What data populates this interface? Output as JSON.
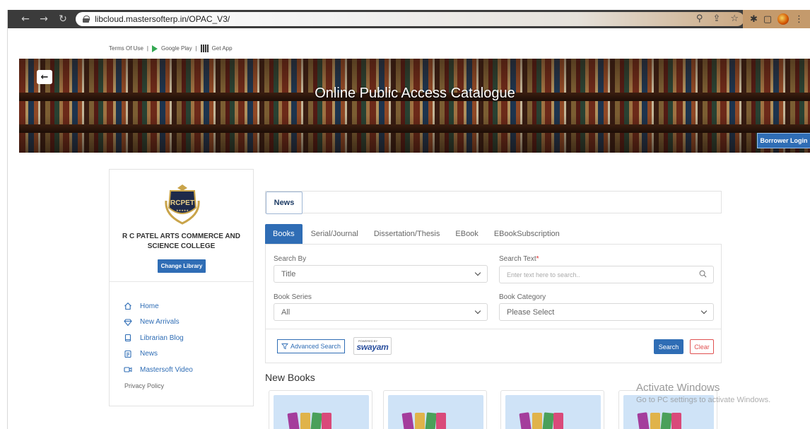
{
  "browser": {
    "url": "libcloud.mastersofterp.in/OPAC_V3/"
  },
  "top_links": {
    "terms": "Terms Of Use",
    "sep1": "|",
    "google_play": "Google Play",
    "sep2": "|",
    "get_app": "Get App"
  },
  "banner": {
    "title": "Online Public Access Catalogue",
    "borrower_login": "Borrower Login"
  },
  "sidebar": {
    "logo_text": "RCPET",
    "college_name_line1": "R C PATEL ARTS COMMERCE AND",
    "college_name_line2": "SCIENCE COLLEGE",
    "change_library": "Change Library",
    "menu": [
      {
        "label": "Home",
        "icon": "home-icon"
      },
      {
        "label": "New Arrivals",
        "icon": "diamond-icon"
      },
      {
        "label": "Librarian Blog",
        "icon": "book-icon"
      },
      {
        "label": "News",
        "icon": "news-icon"
      },
      {
        "label": "Mastersoft Video",
        "icon": "video-icon"
      }
    ],
    "privacy": "Privacy Policy"
  },
  "main": {
    "news_tab": "News",
    "tabs": [
      "Books",
      "Serial/Journal",
      "Dissertation/Thesis",
      "EBook",
      "EBookSubscription"
    ],
    "active_tab": "Books",
    "search": {
      "search_by_label": "Search By",
      "search_by_value": "Title",
      "search_text_label": "Search Text",
      "required_mark": "*",
      "search_text_placeholder": "Enter text here to search..",
      "book_series_label": "Book Series",
      "book_series_value": "All",
      "book_category_label": "Book Category",
      "book_category_value": "Please Select",
      "advanced_search": "Advanced Search",
      "swayam_powered": "POWERED BY",
      "swayam": "swayam",
      "search_button": "Search",
      "clear_button": "Clear"
    },
    "new_books_title": "New Books"
  },
  "os_overlay": {
    "line1": "Activate Windows",
    "line2": "Go to PC settings to activate Windows."
  },
  "colors": {
    "primary": "#2f6db5",
    "danger": "#e05050"
  }
}
